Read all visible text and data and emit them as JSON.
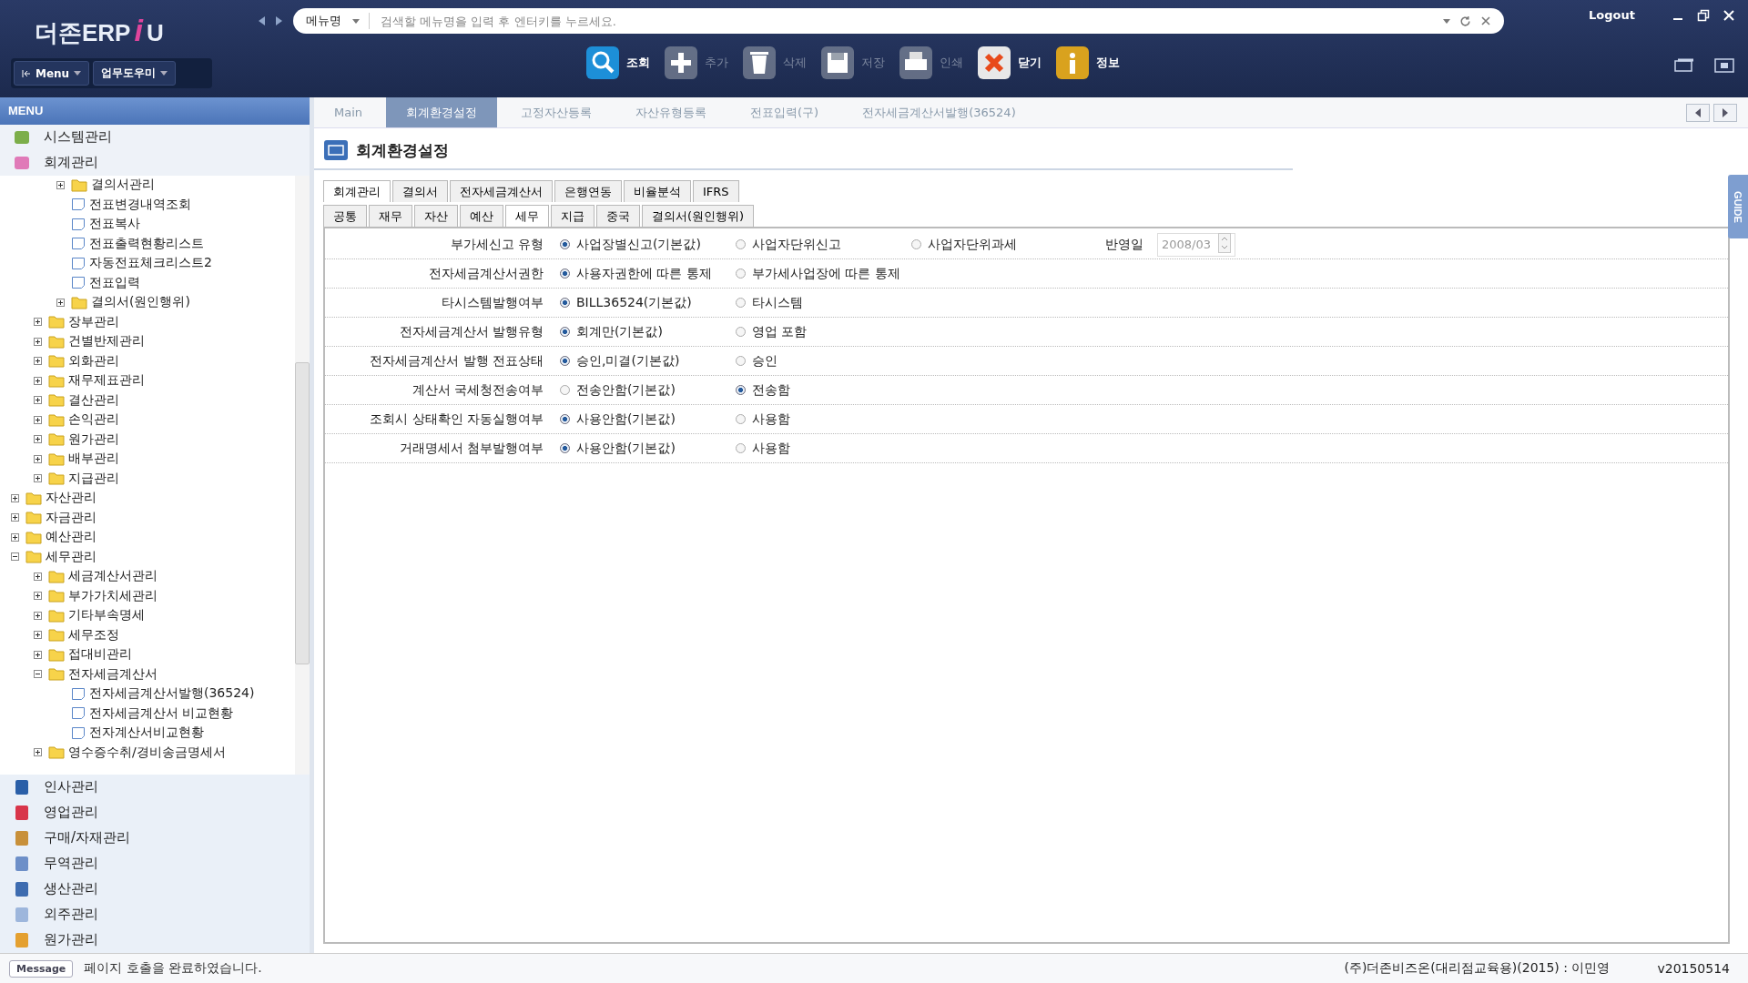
{
  "header": {
    "logo": "더존ERP",
    "logo_mark": "i",
    "logo_tail": "U",
    "search": {
      "scope": "메뉴명",
      "placeholder": "검색할 메뉴명을 입력 후 엔터키를 누르세요."
    },
    "logout": "Logout",
    "menu_button": "Menu",
    "helper_button": "업무도우미"
  },
  "toolbar": [
    {
      "label": "조회",
      "kind": "search",
      "disabled": false
    },
    {
      "label": "추가",
      "kind": "add",
      "disabled": true
    },
    {
      "label": "삭제",
      "kind": "delete",
      "disabled": true
    },
    {
      "label": "저장",
      "kind": "save",
      "disabled": true
    },
    {
      "label": "인쇄",
      "kind": "print",
      "disabled": true
    },
    {
      "label": "닫기",
      "kind": "close",
      "disabled": false
    },
    {
      "label": "정보",
      "kind": "info",
      "disabled": false
    }
  ],
  "sidebar": {
    "title": "MENU",
    "modules_top": [
      {
        "label": "시스템관리",
        "kind": "system"
      },
      {
        "label": "회계관리",
        "kind": "accounting"
      }
    ],
    "tree": [
      {
        "children": [
          {
            "children": [
              {
                "label": "결의서관리",
                "kind": "folder",
                "expanded": false
              },
              {
                "label": "전표변경내역조회",
                "kind": "page"
              },
              {
                "label": "전표복사",
                "kind": "page"
              },
              {
                "label": "전표출력현황리스트",
                "kind": "page"
              },
              {
                "label": "자동전표체크리스트2",
                "kind": "page"
              },
              {
                "label": "전표입력",
                "kind": "page"
              },
              {
                "label": "결의서(원인행위)",
                "kind": "folder",
                "expanded": false
              }
            ]
          },
          {
            "label": "장부관리",
            "kind": "folder",
            "expanded": false
          },
          {
            "label": "건별반제관리",
            "kind": "folder",
            "expanded": false
          },
          {
            "label": "외화관리",
            "kind": "folder",
            "expanded": false
          },
          {
            "label": "재무제표관리",
            "kind": "folder",
            "expanded": false
          },
          {
            "label": "결산관리",
            "kind": "folder",
            "expanded": false
          },
          {
            "label": "손익관리",
            "kind": "folder",
            "expanded": false
          },
          {
            "label": "원가관리",
            "kind": "folder",
            "expanded": false
          },
          {
            "label": "배부관리",
            "kind": "folder",
            "expanded": false
          },
          {
            "label": "지급관리",
            "kind": "folder",
            "expanded": false
          }
        ]
      },
      {
        "label": "자산관리",
        "kind": "folder",
        "expanded": false
      },
      {
        "label": "자금관리",
        "kind": "folder",
        "expanded": false
      },
      {
        "label": "예산관리",
        "kind": "folder",
        "expanded": false
      },
      {
        "label": "세무관리",
        "kind": "folder",
        "expanded": true,
        "children": [
          {
            "label": "세금계산서관리",
            "kind": "folder",
            "expanded": false
          },
          {
            "label": "부가가치세관리",
            "kind": "folder",
            "expanded": false
          },
          {
            "label": "기타부속명세",
            "kind": "folder",
            "expanded": false
          },
          {
            "label": "세무조정",
            "kind": "folder",
            "expanded": false
          },
          {
            "label": "접대비관리",
            "kind": "folder",
            "expanded": false
          },
          {
            "label": "전자세금계산서",
            "kind": "folder",
            "expanded": true,
            "children": [
              {
                "label": "전자세금계산서발행(36524)",
                "kind": "page"
              },
              {
                "label": "전자세금계산서 비교현황",
                "kind": "page"
              },
              {
                "label": "전자계산서비교현황",
                "kind": "page"
              }
            ]
          },
          {
            "label": "영수증수취/경비송금명세서",
            "kind": "folder",
            "expanded": false
          }
        ]
      }
    ],
    "modules_bottom": [
      {
        "label": "인사관리",
        "kind": "hr"
      },
      {
        "label": "영업관리",
        "kind": "sales"
      },
      {
        "label": "구매/자재관리",
        "kind": "purchase"
      },
      {
        "label": "무역관리",
        "kind": "trade"
      },
      {
        "label": "생산관리",
        "kind": "production"
      },
      {
        "label": "외주관리",
        "kind": "outsourcing"
      },
      {
        "label": "원가관리",
        "kind": "cost"
      }
    ]
  },
  "open_tabs": [
    {
      "label": "Main",
      "selected": false
    },
    {
      "label": "회계환경설정",
      "selected": true
    },
    {
      "label": "고정자산등록",
      "selected": false
    },
    {
      "label": "자산유형등록",
      "selected": false
    },
    {
      "label": "전표입력(구)",
      "selected": false
    },
    {
      "label": "전자세금계산서발행(36524)",
      "selected": false
    }
  ],
  "page_title": "회계환경설정",
  "tabs": [
    {
      "label": "회계관리",
      "selected": true
    },
    {
      "label": "결의서",
      "selected": false
    },
    {
      "label": "전자세금계산서",
      "selected": false
    },
    {
      "label": "은행연동",
      "selected": false
    },
    {
      "label": "비율분석",
      "selected": false
    },
    {
      "label": "IFRS",
      "selected": false
    }
  ],
  "subtabs": [
    {
      "label": "공통",
      "selected": false
    },
    {
      "label": "재무",
      "selected": false
    },
    {
      "label": "자산",
      "selected": false
    },
    {
      "label": "예산",
      "selected": false
    },
    {
      "label": "세무",
      "selected": true
    },
    {
      "label": "지급",
      "selected": false
    },
    {
      "label": "중국",
      "selected": false
    },
    {
      "label": "결의서(원인행위)",
      "selected": false
    }
  ],
  "form": {
    "rows": [
      {
        "label": "부가세신고 유형",
        "options": [
          {
            "label": "사업장별신고(기본값)",
            "selected": true
          },
          {
            "label": "사업자단위신고",
            "selected": false
          },
          {
            "label": "사업자단위과세",
            "selected": false
          }
        ],
        "extra": {
          "label": "반영일",
          "value": "2008/03"
        }
      },
      {
        "label": "전자세금계산서권한",
        "options": [
          {
            "label": "사용자권한에 따른 통제",
            "selected": true
          },
          {
            "label": "부가세사업장에 따른 통제",
            "selected": false
          }
        ]
      },
      {
        "label": "타시스템발행여부",
        "options": [
          {
            "label": "BILL36524(기본값)",
            "selected": true
          },
          {
            "label": "타시스템",
            "selected": false
          }
        ]
      },
      {
        "label": "전자세금계산서 발행유형",
        "options": [
          {
            "label": "회계만(기본값)",
            "selected": true
          },
          {
            "label": "영업 포함",
            "selected": false
          }
        ]
      },
      {
        "label": "전자세금계산서 발행 전표상태",
        "options": [
          {
            "label": "승인,미결(기본값)",
            "selected": true
          },
          {
            "label": "승인",
            "selected": false
          }
        ]
      },
      {
        "label": "계산서 국세청전송여부",
        "options": [
          {
            "label": "전송안함(기본값)",
            "selected": false
          },
          {
            "label": "전송함",
            "selected": true
          }
        ]
      },
      {
        "label": "조회시 상태확인 자동실행여부",
        "options": [
          {
            "label": "사용안함(기본값)",
            "selected": true
          },
          {
            "label": "사용함",
            "selected": false
          }
        ]
      },
      {
        "label": "거래명세서 첨부발행여부",
        "options": [
          {
            "label": "사용안함(기본값)",
            "selected": true
          },
          {
            "label": "사용함",
            "selected": false
          }
        ]
      }
    ]
  },
  "guide_tab": "GUIDE",
  "status_bar": {
    "button": "Message",
    "message": "페이지 호출을 완료하였습니다.",
    "company": "(주)더존비즈온(대리점교육용)(2015) : 이민영",
    "version": "v20150514"
  }
}
